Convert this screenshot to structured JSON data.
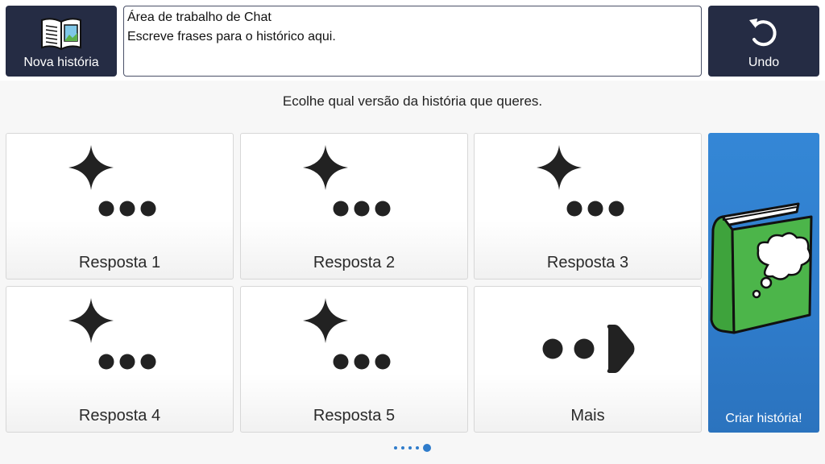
{
  "header": {
    "new_story_label": "Nova história",
    "undo_label": "Undo",
    "workspace": {
      "title": "Área de trabalho de Chat",
      "hint": "Escreve frases para o histórico aqui."
    }
  },
  "instruction": "Ecolhe qual versão da história que queres.",
  "tiles": [
    {
      "label": "Resposta 1",
      "icon": "sparkle-ellipsis-icon"
    },
    {
      "label": "Resposta 2",
      "icon": "sparkle-ellipsis-icon"
    },
    {
      "label": "Resposta 3",
      "icon": "sparkle-ellipsis-icon"
    },
    {
      "label": "Resposta 4",
      "icon": "sparkle-ellipsis-icon"
    },
    {
      "label": "Resposta 5",
      "icon": "sparkle-ellipsis-icon"
    },
    {
      "label": "Mais",
      "icon": "more-arrow-icon"
    }
  ],
  "create_story_label": "Criar história!",
  "pager": {
    "pages": 5,
    "current": 5
  },
  "colors": {
    "dark_button": "#252c44",
    "accent_blue": "#2f7ccb",
    "book_green": "#4cb54a"
  }
}
